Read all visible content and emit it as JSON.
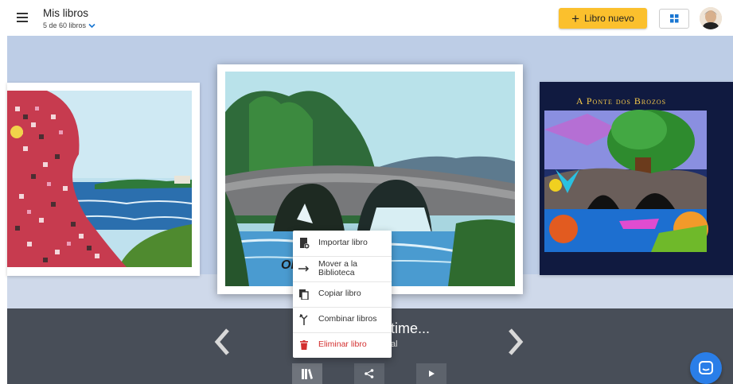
{
  "header": {
    "title": "Mis libros",
    "subtitle": "5 de 60 libros",
    "new_book_label": "Libro nuevo"
  },
  "right_book": {
    "title": "A Ponte dos Brozos"
  },
  "center_book": {
    "cover_text": "ON"
  },
  "selected_book": {
    "title_fragment": "time...",
    "sub_fragment": "al"
  },
  "context_menu": {
    "items": [
      {
        "label": "Importar libro",
        "icon": "import-book-icon"
      },
      {
        "label": "Mover a la Biblioteca",
        "icon": "arrow-right-icon"
      },
      {
        "label": "Copiar libro",
        "icon": "copy-icon"
      },
      {
        "label": "Combinar libros",
        "icon": "merge-icon"
      },
      {
        "label": "Eliminar libro",
        "icon": "trash-icon",
        "color": "#d32f2f"
      }
    ]
  },
  "colors": {
    "accent": "#fbc02d",
    "carousel_bg": "#bdcde6",
    "dark_bg": "#484e58",
    "chat": "#2a7ee8",
    "danger": "#d32f2f"
  }
}
